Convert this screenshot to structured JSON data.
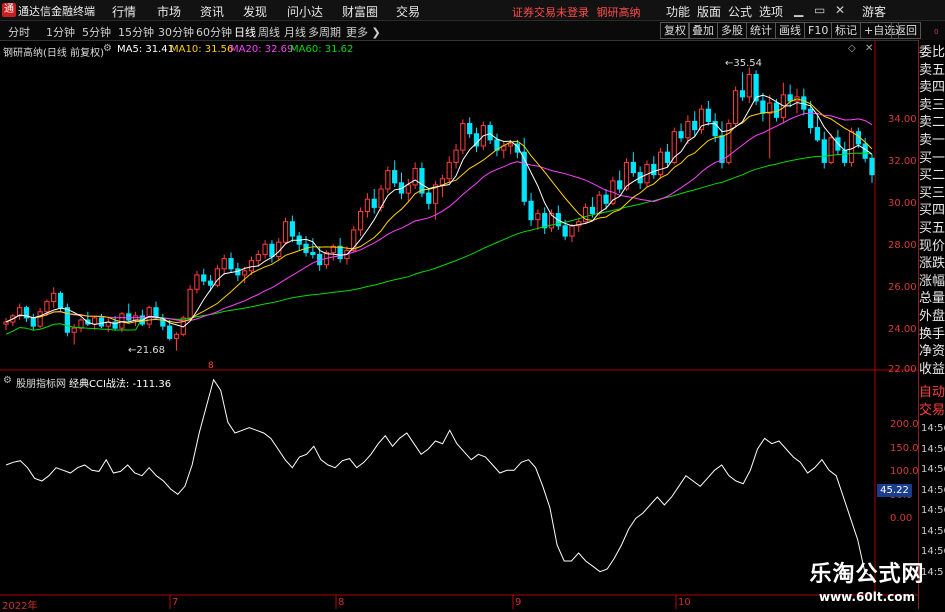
{
  "app": {
    "title": "通达信金融终端"
  },
  "menu": {
    "items": [
      "行情",
      "市场",
      "资讯",
      "发现",
      "问小达",
      "财富圈",
      "交易"
    ],
    "status": "证券交易未登录",
    "stock": "钢研高纳",
    "right": [
      "功能",
      "版面",
      "公式",
      "选项"
    ],
    "guest": "游客"
  },
  "toolbar": {
    "periods": [
      "分时",
      "1分钟",
      "5分钟",
      "15分钟",
      "30分钟",
      "60分钟",
      "日线",
      "周线",
      "月线",
      "多周期",
      "更多"
    ],
    "active": "日线",
    "right": [
      "复权",
      "叠加",
      "多股",
      "统计",
      "画线",
      "F10",
      "标记",
      "+自选",
      "返回"
    ]
  },
  "chart": {
    "label": "钢研高纳(日线 前复权)",
    "ma5": "MA5: 31.41",
    "ma10": "MA10: 31.56",
    "ma20": "MA20: 32.69",
    "ma60": "MA60: 31.62",
    "high_label": "35.54",
    "low_label": "21.68",
    "marker": "8",
    "yticks": [
      "34.00",
      "32.00",
      "30.00",
      "28.00",
      "26.00",
      "24.00",
      "22.00"
    ]
  },
  "indicator": {
    "label": "股朋指标网",
    "formula": "经典CCI战法: -111.36",
    "yticks": [
      "200.0",
      "150.0",
      "100.0",
      "50.0",
      "0.00"
    ],
    "current": "45.22"
  },
  "xaxis": {
    "ticks": [
      "2022年",
      "7",
      "8",
      "9",
      "10"
    ]
  },
  "side": {
    "items": [
      "委比",
      "卖五",
      "卖四",
      "卖三",
      "卖二",
      "卖一",
      "买一",
      "买二",
      "买三",
      "买四",
      "买五",
      "现价",
      "涨跌",
      "涨幅",
      "总量",
      "外盘",
      "换手",
      "净资",
      "收益"
    ],
    "top_small": "0",
    "auto": "自动",
    "trade": "交易",
    "times": [
      "14:56",
      "14:56",
      "14:56",
      "14:56",
      "14:56",
      "14:56",
      "14:56",
      "14:5"
    ]
  },
  "watermark": {
    "title": "乐淘公式网",
    "url": "www.60lt.com"
  },
  "chart_data": {
    "type": "line",
    "title": "钢研高纳(日线 前复权)",
    "candles": [
      [
        23.0,
        23.3,
        22.7,
        23.1
      ],
      [
        23.1,
        23.5,
        22.9,
        23.4
      ],
      [
        23.4,
        24.0,
        23.2,
        23.8
      ],
      [
        23.8,
        23.9,
        23.1,
        23.3
      ],
      [
        23.3,
        23.5,
        22.7,
        22.9
      ],
      [
        22.9,
        23.8,
        22.8,
        23.6
      ],
      [
        23.6,
        24.2,
        23.4,
        24.1
      ],
      [
        24.1,
        24.8,
        23.8,
        24.5
      ],
      [
        24.5,
        24.6,
        23.6,
        23.8
      ],
      [
        23.8,
        24.0,
        22.4,
        22.6
      ],
      [
        22.6,
        23.0,
        22.0,
        22.8
      ],
      [
        22.8,
        23.3,
        22.6,
        23.2
      ],
      [
        23.2,
        23.6,
        22.9,
        23.0
      ],
      [
        23.0,
        23.4,
        22.7,
        23.3
      ],
      [
        23.3,
        23.5,
        22.8,
        22.9
      ],
      [
        22.9,
        23.3,
        22.6,
        23.1
      ],
      [
        23.1,
        23.4,
        22.7,
        22.8
      ],
      [
        22.8,
        23.6,
        22.6,
        23.5
      ],
      [
        23.5,
        24.0,
        23.1,
        23.2
      ],
      [
        23.2,
        23.6,
        22.9,
        23.4
      ],
      [
        23.4,
        23.7,
        22.9,
        23.0
      ],
      [
        23.0,
        23.9,
        22.8,
        23.8
      ],
      [
        23.8,
        24.1,
        23.2,
        23.3
      ],
      [
        23.3,
        23.5,
        22.7,
        22.9
      ],
      [
        22.9,
        23.2,
        22.2,
        22.3
      ],
      [
        22.3,
        22.6,
        21.7,
        22.5
      ],
      [
        22.5,
        23.4,
        22.4,
        23.3
      ],
      [
        23.3,
        24.9,
        23.2,
        24.7
      ],
      [
        24.7,
        25.6,
        24.5,
        25.4
      ],
      [
        25.4,
        25.7,
        24.9,
        25.1
      ],
      [
        25.1,
        25.4,
        24.6,
        24.9
      ],
      [
        24.9,
        25.9,
        24.8,
        25.7
      ],
      [
        25.7,
        26.4,
        25.4,
        26.2
      ],
      [
        26.2,
        26.5,
        25.5,
        25.7
      ],
      [
        25.7,
        26.0,
        25.1,
        25.4
      ],
      [
        25.4,
        25.8,
        25.0,
        25.6
      ],
      [
        25.6,
        26.3,
        25.4,
        26.1
      ],
      [
        26.1,
        26.6,
        25.8,
        26.4
      ],
      [
        26.4,
        27.1,
        26.2,
        26.9
      ],
      [
        26.9,
        27.1,
        26.0,
        26.3
      ],
      [
        26.3,
        27.2,
        26.1,
        27.0
      ],
      [
        27.0,
        28.2,
        26.9,
        28.0
      ],
      [
        28.0,
        28.3,
        27.0,
        27.3
      ],
      [
        27.3,
        27.5,
        26.6,
        26.9
      ],
      [
        26.9,
        27.3,
        26.3,
        26.5
      ],
      [
        26.5,
        27.2,
        26.2,
        26.4
      ],
      [
        26.4,
        26.8,
        25.6,
        25.9
      ],
      [
        25.9,
        26.6,
        25.7,
        26.5
      ],
      [
        26.5,
        26.9,
        26.1,
        26.8
      ],
      [
        26.8,
        27.2,
        26.0,
        26.2
      ],
      [
        26.2,
        26.8,
        25.9,
        26.6
      ],
      [
        26.6,
        27.8,
        26.5,
        27.6
      ],
      [
        27.6,
        28.7,
        27.3,
        28.5
      ],
      [
        28.5,
        29.4,
        28.2,
        29.1
      ],
      [
        29.1,
        29.6,
        28.4,
        28.7
      ],
      [
        28.7,
        29.8,
        28.5,
        29.6
      ],
      [
        29.6,
        30.7,
        29.4,
        30.5
      ],
      [
        30.5,
        31.0,
        29.7,
        29.9
      ],
      [
        29.9,
        30.4,
        29.1,
        29.4
      ],
      [
        29.4,
        30.1,
        29.0,
        29.8
      ],
      [
        29.8,
        30.9,
        29.6,
        30.6
      ],
      [
        30.6,
        30.9,
        29.2,
        29.4
      ],
      [
        29.4,
        29.6,
        28.6,
        28.9
      ],
      [
        28.9,
        30.0,
        28.1,
        29.8
      ],
      [
        29.8,
        30.3,
        29.2,
        30.1
      ],
      [
        30.1,
        31.2,
        29.9,
        30.9
      ],
      [
        30.9,
        31.8,
        30.6,
        31.5
      ],
      [
        31.5,
        33.0,
        31.3,
        32.8
      ],
      [
        32.8,
        33.1,
        32.1,
        32.3
      ],
      [
        32.3,
        32.6,
        31.4,
        31.7
      ],
      [
        31.7,
        32.9,
        31.5,
        32.7
      ],
      [
        32.7,
        32.9,
        31.8,
        32.0
      ],
      [
        32.0,
        32.3,
        31.2,
        31.5
      ],
      [
        31.5,
        31.9,
        31.1,
        31.7
      ],
      [
        31.7,
        32.0,
        31.3,
        31.8
      ],
      [
        31.8,
        32.0,
        31.1,
        31.4
      ],
      [
        31.4,
        32.1,
        28.8,
        29.0
      ],
      [
        29.0,
        29.4,
        27.8,
        28.1
      ],
      [
        28.1,
        28.6,
        27.6,
        28.4
      ],
      [
        28.4,
        28.7,
        27.4,
        27.7
      ],
      [
        27.7,
        28.6,
        27.5,
        28.4
      ],
      [
        28.4,
        28.8,
        27.6,
        27.8
      ],
      [
        27.8,
        28.1,
        27.1,
        27.3
      ],
      [
        27.3,
        27.9,
        27.0,
        27.8
      ],
      [
        27.8,
        28.2,
        27.5,
        28.0
      ],
      [
        28.0,
        28.9,
        27.9,
        28.7
      ],
      [
        28.7,
        29.2,
        28.2,
        28.4
      ],
      [
        28.4,
        29.5,
        28.3,
        29.3
      ],
      [
        29.3,
        29.6,
        28.6,
        28.9
      ],
      [
        28.9,
        30.2,
        28.8,
        30.0
      ],
      [
        30.0,
        30.5,
        29.4,
        29.6
      ],
      [
        29.6,
        31.1,
        29.5,
        30.9
      ],
      [
        30.9,
        31.4,
        30.2,
        30.4
      ],
      [
        30.4,
        30.7,
        29.6,
        29.9
      ],
      [
        29.9,
        31.0,
        29.7,
        30.8
      ],
      [
        30.8,
        31.2,
        30.1,
        30.3
      ],
      [
        30.3,
        31.6,
        30.1,
        31.4
      ],
      [
        31.4,
        31.8,
        30.7,
        30.9
      ],
      [
        30.9,
        32.6,
        30.8,
        32.4
      ],
      [
        32.4,
        32.8,
        31.9,
        32.1
      ],
      [
        32.1,
        33.2,
        31.8,
        32.9
      ],
      [
        32.9,
        33.4,
        32.2,
        32.5
      ],
      [
        32.5,
        33.7,
        32.3,
        33.5
      ],
      [
        33.5,
        33.9,
        32.7,
        32.9
      ],
      [
        32.9,
        33.3,
        31.9,
        32.2
      ],
      [
        32.2,
        32.9,
        30.6,
        30.9
      ],
      [
        30.9,
        33.0,
        30.8,
        32.8
      ],
      [
        32.8,
        34.6,
        32.6,
        34.4
      ],
      [
        34.4,
        35.3,
        33.9,
        34.1
      ],
      [
        34.1,
        35.54,
        33.8,
        35.2
      ],
      [
        35.2,
        35.4,
        33.7,
        33.9
      ],
      [
        33.9,
        34.3,
        32.9,
        33.3
      ],
      [
        33.3,
        34.2,
        31.1,
        33.8
      ],
      [
        33.8,
        34.0,
        32.9,
        33.1
      ],
      [
        33.1,
        34.8,
        32.8,
        34.2
      ],
      [
        34.2,
        34.7,
        33.6,
        33.9
      ],
      [
        33.9,
        34.5,
        33.3,
        34.1
      ],
      [
        34.1,
        34.5,
        33.2,
        33.5
      ],
      [
        33.5,
        33.9,
        32.3,
        32.6
      ],
      [
        32.6,
        33.2,
        31.9,
        32.0
      ],
      [
        32.0,
        32.4,
        30.6,
        30.9
      ],
      [
        30.9,
        32.3,
        30.8,
        32.1
      ],
      [
        32.1,
        32.5,
        31.3,
        31.5
      ],
      [
        31.5,
        31.9,
        30.7,
        30.9
      ],
      [
        30.9,
        32.6,
        30.7,
        32.4
      ],
      [
        32.4,
        32.6,
        31.6,
        31.8
      ],
      [
        31.8,
        32.1,
        30.9,
        31.1
      ],
      [
        31.1,
        31.3,
        29.9,
        30.3
      ]
    ],
    "cci": [
      100,
      105,
      108,
      95,
      75,
      70,
      80,
      95,
      90,
      85,
      95,
      100,
      90,
      88,
      110,
      85,
      88,
      100,
      85,
      80,
      95,
      80,
      70,
      55,
      45,
      60,
      100,
      160,
      210,
      260,
      240,
      180,
      160,
      165,
      170,
      165,
      160,
      150,
      130,
      110,
      95,
      115,
      120,
      135,
      110,
      100,
      95,
      108,
      112,
      95,
      105,
      120,
      140,
      155,
      135,
      150,
      160,
      140,
      120,
      130,
      145,
      140,
      165,
      140,
      125,
      110,
      120,
      115,
      100,
      85,
      90,
      90,
      105,
      110,
      95,
      60,
      20,
      -50,
      -80,
      -80,
      -65,
      -80,
      -90,
      -100,
      -95,
      -75,
      -50,
      -20,
      0,
      10,
      25,
      40,
      25,
      40,
      60,
      80,
      70,
      60,
      75,
      90,
      100,
      80,
      70,
      65,
      90,
      130,
      150,
      140,
      145,
      130,
      115,
      105,
      85,
      95,
      110,
      90,
      80,
      40,
      0,
      -40,
      -100,
      -111.36
    ],
    "ma5_value": 31.41,
    "ma10_value": 31.56,
    "ma20_value": 32.69,
    "ma60_value": 31.62,
    "price_ylim": [
      21.0,
      36.0
    ],
    "cci_ylim": [
      -125,
      250
    ],
    "colors": {
      "up": "#ff3c3c",
      "down": "#00e5ff",
      "ma5": "#ffffff",
      "ma10": "#ffd200",
      "ma20": "#ff40ff",
      "ma60": "#00dd00",
      "cci": "#ffffff",
      "axis": "#c00000"
    }
  }
}
